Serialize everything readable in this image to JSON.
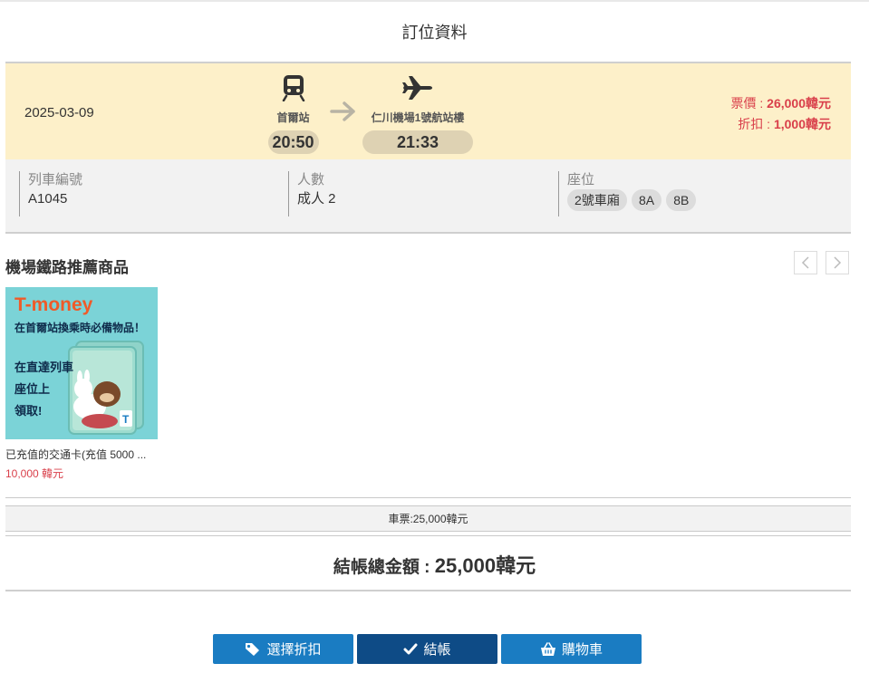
{
  "page": {
    "title": "訂位資料"
  },
  "booking": {
    "date": "2025-03-09",
    "origin": {
      "name": "首爾站",
      "time": "20:50"
    },
    "destination": {
      "name": "仁川機場1號航站樓",
      "time": "21:33"
    },
    "fare_label": "票價 : ",
    "fare_value": "26,000韓元",
    "discount_label": "折扣 : ",
    "discount_value": "1,000韓元"
  },
  "details": {
    "train_label": "列車編號",
    "train_value": "A1045",
    "people_label": "人數",
    "people_value": "成人 2",
    "seat_label": "座位",
    "seats": [
      "2號車廂",
      "8A",
      "8B"
    ]
  },
  "recommend": {
    "title": "機場鐵路推薦商品",
    "products": [
      {
        "name": "已充值的交通卡(充值 5000 ...",
        "price": "10,000 韓元",
        "image_text": {
          "brand": "T-money",
          "line1": "在首爾站換乘時必備物品！",
          "line2": "在直達列車",
          "line3": "座位上",
          "line4": "領取!"
        }
      }
    ]
  },
  "summary": {
    "fare_text": "車票:25,000韓元",
    "total_label": "結帳總金額 : ",
    "total_value": "25,000韓元"
  },
  "buttons": {
    "discount": "選擇折扣",
    "checkout": "結帳",
    "cart": "購物車"
  },
  "colors": {
    "accent": "#1a7cc2",
    "accent_dark": "#0e4b86",
    "price_red": "#d93f4a",
    "summary_bg": "#fdf0c9",
    "product_bg": "#7bd3d7",
    "brand_orange": "#f05a28"
  },
  "icons": {
    "origin": "train-icon",
    "arrow": "arrow-right-icon",
    "destination": "airplane-icon",
    "discount": "tag-icon",
    "checkout": "check-icon",
    "cart": "basket-icon",
    "prev": "chevron-left-icon",
    "next": "chevron-right-icon"
  }
}
